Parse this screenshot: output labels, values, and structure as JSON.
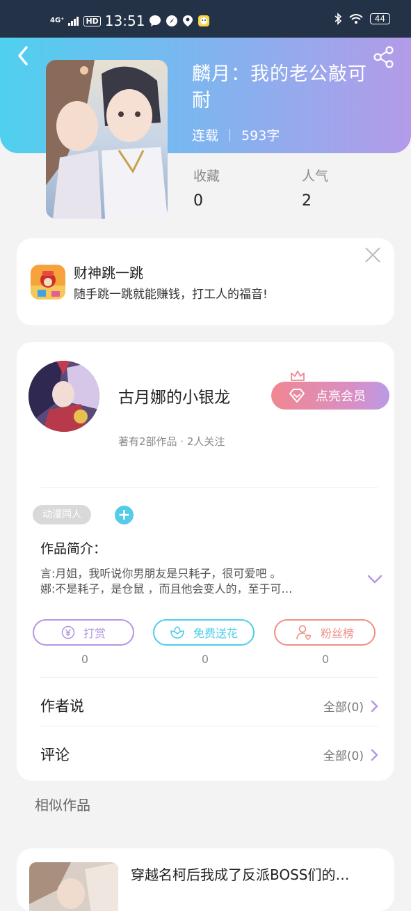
{
  "status_bar": {
    "network": "4G⁺",
    "hd": "HD",
    "time": "13:51",
    "battery": "44"
  },
  "book": {
    "title": "麟月：我的老公敲可耐",
    "status": "连载",
    "word_count": "593字",
    "stats": [
      {
        "label": "收藏",
        "value": "0"
      },
      {
        "label": "人气",
        "value": "2"
      }
    ]
  },
  "ad": {
    "title": "财神跳一跳",
    "description": "随手跳一跳就能赚钱，打工人的福音!"
  },
  "author": {
    "name": "古月娜的小银龙",
    "meta": "著有2部作品 · 2人关注",
    "vip_button": "点亮会员"
  },
  "tags": [
    "动漫同人"
  ],
  "add_tag": "+",
  "intro": {
    "label": "作品简介：",
    "lines": [
      "言:月姐，我听说你男朋友是只耗子，很可爱吧 。",
      "娜:不是耗子，是仓鼠 ，而且他会变人的，至于可…"
    ]
  },
  "actions": [
    {
      "label": "打赏",
      "count": "0",
      "color": "#b497e3",
      "icon": "yen-icon"
    },
    {
      "label": "免费送花",
      "count": "0",
      "color": "#4fcdea",
      "icon": "flower-icon"
    },
    {
      "label": "粉丝榜",
      "count": "0",
      "color": "#ef8f89",
      "icon": "fans-icon"
    }
  ],
  "rows": [
    {
      "label": "作者说",
      "right": "全部(0)"
    },
    {
      "label": "评论",
      "right": "全部(0)"
    }
  ],
  "similar": {
    "label": "相似作品",
    "items": [
      {
        "title": "穿越名柯后我成了反派BOSS们的…"
      }
    ]
  },
  "colors": {
    "header_gradient_start": "#4fd0ee",
    "header_gradient_end": "#b49be9",
    "accent_purple": "#b497e3",
    "accent_blue": "#4fcdea",
    "accent_red": "#ef8f89",
    "chevron": "#b497e3"
  }
}
